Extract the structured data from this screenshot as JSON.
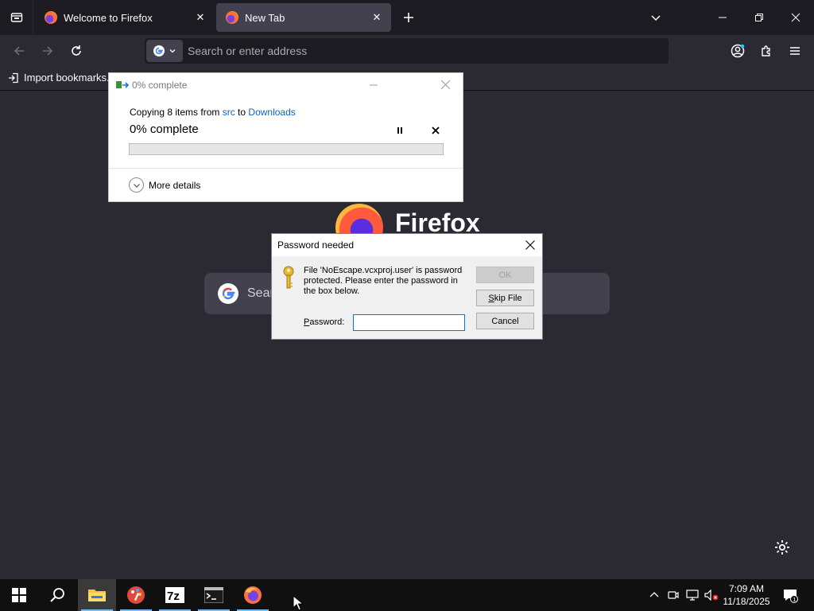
{
  "browser": {
    "tabs": [
      {
        "title": "Welcome to Firefox",
        "active": false
      },
      {
        "title": "New Tab",
        "active": true
      }
    ],
    "urlbar": {
      "placeholder": "Search or enter address"
    },
    "bookmarks": {
      "import_label": "Import bookmarks..."
    },
    "newtab": {
      "brand": "Firefox",
      "search_placeholder": "Search"
    }
  },
  "copy_dialog": {
    "title": "0% complete",
    "line_prefix": "Copying 8 items from ",
    "source": "src",
    "line_middle": " to ",
    "destination": "Downloads",
    "status": "0% complete",
    "progress_fraction": 0,
    "more_details": "More details"
  },
  "password_dialog": {
    "title": "Password needed",
    "message": "File 'NoEscape.vcxproj.user' is password protected.  Please enter the password in the box below.",
    "password_label_accel": "P",
    "password_label_rest": "assword:",
    "password_value": "",
    "ok_label": "OK",
    "skip_accel": "S",
    "skip_rest": "kip File",
    "cancel_label": "Cancel"
  },
  "taskbar": {
    "time": "7:09 AM",
    "date": "11/18/2025",
    "notification_count": "1",
    "apps": [
      "file-explorer",
      "paint",
      "7zip",
      "terminal",
      "firefox"
    ],
    "accent": "#76b9ed"
  }
}
